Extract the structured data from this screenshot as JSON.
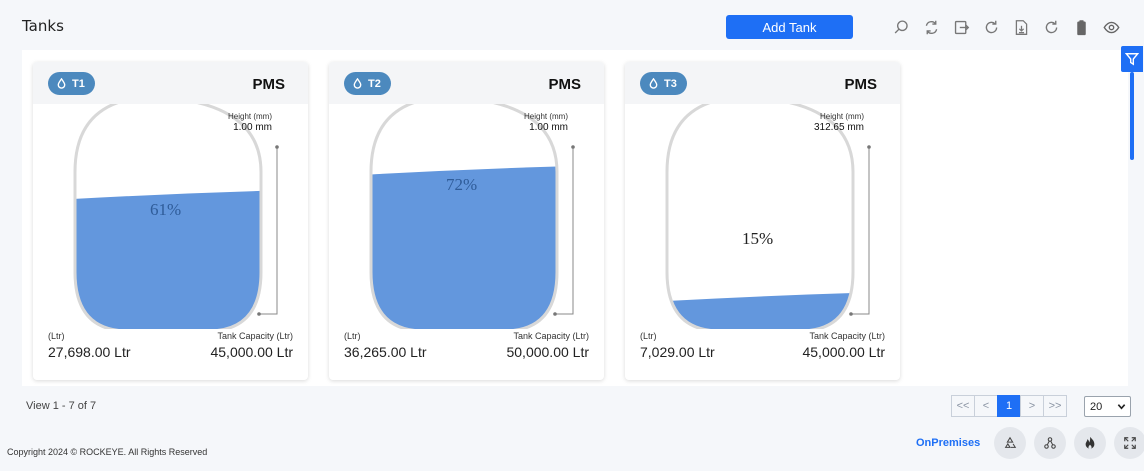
{
  "header": {
    "title": "Tanks",
    "add_button": "Add Tank"
  },
  "toolbar_icons": [
    "search-icon",
    "sync-icon",
    "export-icon",
    "refresh-icon",
    "download-icon",
    "reload-icon",
    "clipboard-icon",
    "eye-icon"
  ],
  "tanks": [
    {
      "badge": "T1",
      "product": "PMS",
      "height_label": "Height (mm)",
      "height_value": "1.00 mm",
      "percent_text": "61%",
      "fill": 0.61,
      "volume_label": "(Ltr)",
      "volume_value": "27,698.00 Ltr",
      "capacity_label": "Tank Capacity (Ltr)",
      "capacity_value": "45,000.00 Ltr"
    },
    {
      "badge": "T2",
      "product": "PMS",
      "height_label": "Height (mm)",
      "height_value": "1.00 mm",
      "percent_text": "72%",
      "fill": 0.72,
      "volume_label": "(Ltr)",
      "volume_value": "36,265.00 Ltr",
      "capacity_label": "Tank Capacity (Ltr)",
      "capacity_value": "50,000.00 Ltr"
    },
    {
      "badge": "T3",
      "product": "PMS",
      "height_label": "Height (mm)",
      "height_value": "312.65 mm",
      "percent_text": "15%",
      "fill": 0.15,
      "volume_label": "(Ltr)",
      "volume_value": "7,029.00 Ltr",
      "capacity_label": "Tank Capacity (Ltr)",
      "capacity_value": "45,000.00 Ltr"
    }
  ],
  "pagination": {
    "view_info": "View 1 - 7 of 7",
    "first": "<<",
    "prev": "<",
    "current": "1",
    "next": ">",
    "last": ">>",
    "page_size": "20"
  },
  "footer": {
    "copyright": "Copyright 2024 © ROCKEYE. All Rights Reserved",
    "mode": "OnPremises"
  },
  "colors": {
    "accent": "#1e6ff5",
    "fill": "#6397dd",
    "badge": "#4c89be"
  }
}
